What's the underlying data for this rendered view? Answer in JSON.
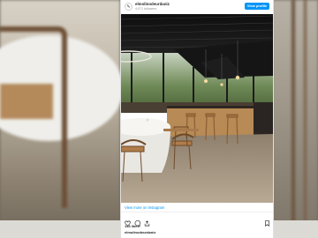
{
  "post": {
    "username": "elmolinodeurdaniz",
    "followers": "4,071 followers",
    "view_profile_label": "View profile",
    "view_more_label": "View more on Instagram",
    "likes": "146 likes",
    "caption_user": "elmolinodeurdaniz",
    "avatar_glyph": "✎"
  },
  "icons": {
    "like": "heart-icon",
    "comment": "comment-icon",
    "share": "share-icon",
    "save": "bookmark-icon"
  },
  "colors": {
    "accent": "#0095f6",
    "text": "#262626",
    "muted": "#8e8e8e"
  }
}
